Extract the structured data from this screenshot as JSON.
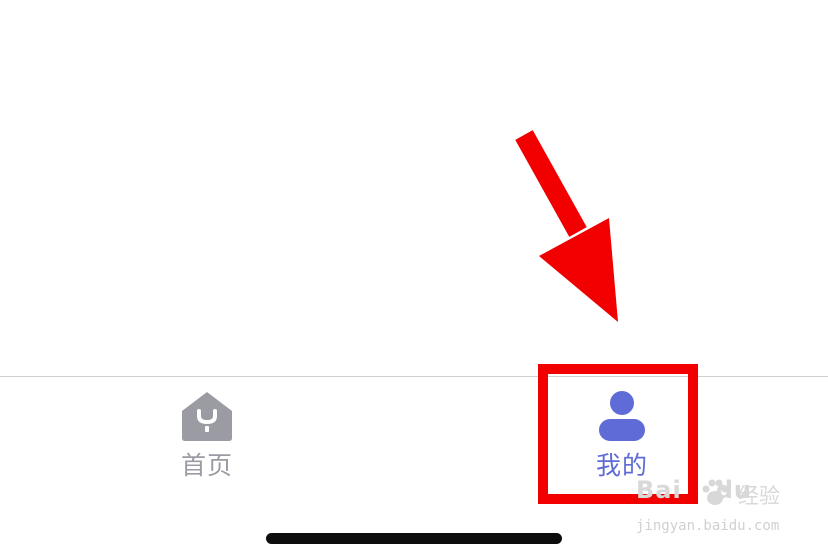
{
  "tabbar": {
    "tabs": [
      {
        "id": "home",
        "label": "首页",
        "icon": "home-icon",
        "active": false,
        "color": "#9b9ba3"
      },
      {
        "id": "mine",
        "label": "我的",
        "icon": "user-icon",
        "active": true,
        "color": "#5f6bd6"
      }
    ]
  },
  "annotation": {
    "arrow_color": "#f20000",
    "box_color": "#f20000"
  },
  "watermark": {
    "brand_left": "Bai",
    "brand_right": "du",
    "product": "经验",
    "url": "jingyan.baidu.com"
  }
}
